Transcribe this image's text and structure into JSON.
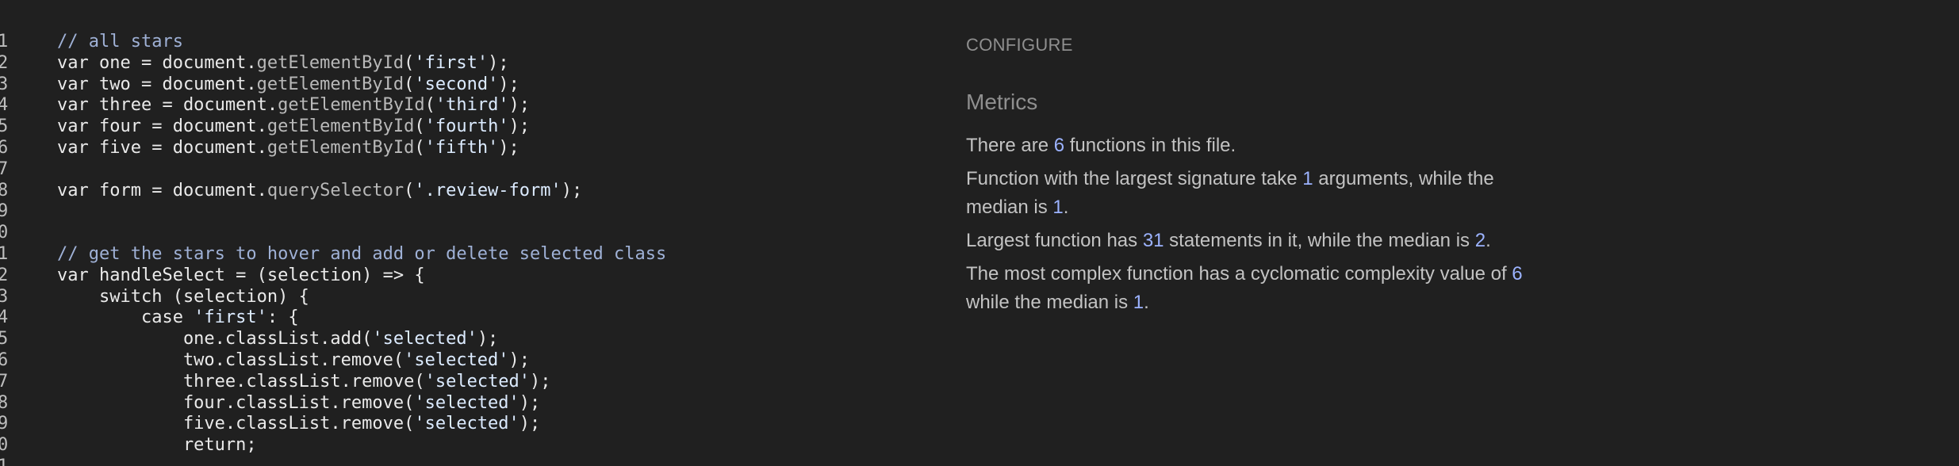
{
  "editor": {
    "lines": [
      {
        "number": "1",
        "tokens": [
          {
            "text": "// all stars",
            "kind": "comment"
          }
        ]
      },
      {
        "number": "2",
        "tokens": [
          {
            "text": "var one = document.",
            "kind": "plain"
          },
          {
            "text": "getElementById",
            "kind": "method"
          },
          {
            "text": "(",
            "kind": "plain"
          },
          {
            "text": "'first'",
            "kind": "string"
          },
          {
            "text": ");",
            "kind": "plain"
          }
        ]
      },
      {
        "number": "3",
        "tokens": [
          {
            "text": "var two = document.",
            "kind": "plain"
          },
          {
            "text": "getElementById",
            "kind": "method"
          },
          {
            "text": "(",
            "kind": "plain"
          },
          {
            "text": "'second'",
            "kind": "string"
          },
          {
            "text": ");",
            "kind": "plain"
          }
        ]
      },
      {
        "number": "4",
        "tokens": [
          {
            "text": "var three = document.",
            "kind": "plain"
          },
          {
            "text": "getElementById",
            "kind": "method"
          },
          {
            "text": "(",
            "kind": "plain"
          },
          {
            "text": "'third'",
            "kind": "string"
          },
          {
            "text": ");",
            "kind": "plain"
          }
        ]
      },
      {
        "number": "5",
        "tokens": [
          {
            "text": "var four = document.",
            "kind": "plain"
          },
          {
            "text": "getElementById",
            "kind": "method"
          },
          {
            "text": "(",
            "kind": "plain"
          },
          {
            "text": "'fourth'",
            "kind": "string"
          },
          {
            "text": ");",
            "kind": "plain"
          }
        ]
      },
      {
        "number": "6",
        "tokens": [
          {
            "text": "var five = document.",
            "kind": "plain"
          },
          {
            "text": "getElementById",
            "kind": "method"
          },
          {
            "text": "(",
            "kind": "plain"
          },
          {
            "text": "'fifth'",
            "kind": "string"
          },
          {
            "text": ");",
            "kind": "plain"
          }
        ]
      },
      {
        "number": "7",
        "tokens": []
      },
      {
        "number": "8",
        "tokens": [
          {
            "text": "var form = document.",
            "kind": "plain"
          },
          {
            "text": "querySelector",
            "kind": "method"
          },
          {
            "text": "(",
            "kind": "plain"
          },
          {
            "text": "'.review-form'",
            "kind": "string"
          },
          {
            "text": ");",
            "kind": "plain"
          }
        ]
      },
      {
        "number": "9",
        "tokens": []
      },
      {
        "number": "0",
        "tokens": []
      },
      {
        "number": "1",
        "tokens": [
          {
            "text": "// get the stars to hover and add or delete selected class",
            "kind": "comment"
          }
        ]
      },
      {
        "number": "2",
        "tokens": [
          {
            "text": "var handleSelect = (selection) => {",
            "kind": "plain"
          }
        ]
      },
      {
        "number": "3",
        "tokens": [
          {
            "text": "    switch (selection) {",
            "kind": "plain"
          }
        ]
      },
      {
        "number": "4",
        "tokens": [
          {
            "text": "        case ",
            "kind": "plain"
          },
          {
            "text": "'first'",
            "kind": "string"
          },
          {
            "text": ": {",
            "kind": "plain"
          }
        ]
      },
      {
        "number": "5",
        "tokens": [
          {
            "text": "            one.classList.add(",
            "kind": "plain"
          },
          {
            "text": "'selected'",
            "kind": "string"
          },
          {
            "text": ");",
            "kind": "plain"
          }
        ]
      },
      {
        "number": "6",
        "tokens": [
          {
            "text": "            two.classList.remove(",
            "kind": "plain"
          },
          {
            "text": "'selected'",
            "kind": "string"
          },
          {
            "text": ");",
            "kind": "plain"
          }
        ]
      },
      {
        "number": "7",
        "tokens": [
          {
            "text": "            three.classList.remove(",
            "kind": "plain"
          },
          {
            "text": "'selected'",
            "kind": "string"
          },
          {
            "text": ");",
            "kind": "plain"
          }
        ]
      },
      {
        "number": "8",
        "tokens": [
          {
            "text": "            four.classList.remove(",
            "kind": "plain"
          },
          {
            "text": "'selected'",
            "kind": "string"
          },
          {
            "text": ");",
            "kind": "plain"
          }
        ]
      },
      {
        "number": "9",
        "tokens": [
          {
            "text": "            five.classList.remove(",
            "kind": "plain"
          },
          {
            "text": "'selected'",
            "kind": "string"
          },
          {
            "text": ");",
            "kind": "plain"
          }
        ]
      },
      {
        "number": "0",
        "tokens": [
          {
            "text": "            return;",
            "kind": "plain"
          }
        ]
      },
      {
        "number": "1",
        "tokens": []
      }
    ]
  },
  "panel": {
    "configure_label": "CONFIGURE",
    "metrics_title": "Metrics",
    "metric_1": {
      "before": "There are ",
      "value": "6",
      "after": " functions in this file."
    },
    "metric_2": {
      "before": "Function with the largest signature take ",
      "value_1": "1",
      "middle": " arguments, while the median is ",
      "value_2": "1",
      "after": "."
    },
    "metric_3": {
      "before": "Largest function has ",
      "value_1": "31",
      "middle": " statements in it, while the median is ",
      "value_2": "2",
      "after": "."
    },
    "metric_4": {
      "before": "The most complex function has a cyclomatic complexity value of ",
      "value_1": "6",
      "middle": " while the median is ",
      "value_2": "1",
      "after": "."
    }
  },
  "colors": {
    "background": "#202020",
    "comment": "#9fb1d6",
    "string": "#dcebff",
    "method": "#b9b9b9",
    "metric_value": "#9cb3ff"
  }
}
